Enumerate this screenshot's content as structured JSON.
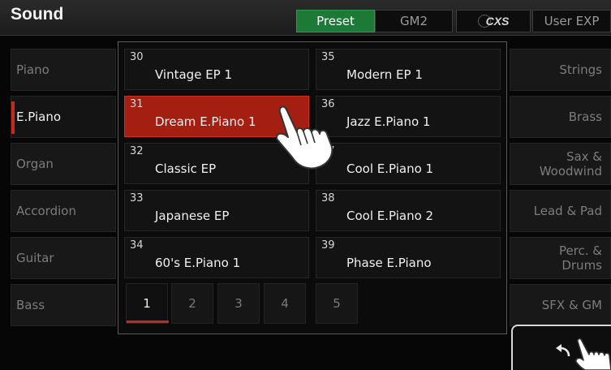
{
  "header": {
    "title": "Sound"
  },
  "tabs": [
    {
      "label": "Preset",
      "active": true
    },
    {
      "label": "GM2",
      "active": false
    },
    {
      "label": "CXS",
      "active": false
    },
    {
      "label": "User EXP",
      "active": false
    }
  ],
  "left_categories": [
    {
      "label": "Piano"
    },
    {
      "label": "E.Piano",
      "active": true
    },
    {
      "label": "Organ"
    },
    {
      "label": "Accordion"
    },
    {
      "label": "Guitar"
    },
    {
      "label": "Bass"
    }
  ],
  "right_categories": [
    {
      "label": "Strings"
    },
    {
      "label": "Brass"
    },
    {
      "label": "Sax &",
      "label2": "Woodwind"
    },
    {
      "label": "Lead & Pad"
    },
    {
      "label": "Perc. &",
      "label2": "Drums"
    },
    {
      "label": "SFX & GM"
    }
  ],
  "voices_left": [
    {
      "num": "30",
      "name": "Vintage EP 1"
    },
    {
      "num": "31",
      "name": "Dream E.Piano 1",
      "selected": true
    },
    {
      "num": "32",
      "name": "Classic EP"
    },
    {
      "num": "33",
      "name": "Japanese EP"
    },
    {
      "num": "34",
      "name": "60's E.Piano 1"
    }
  ],
  "voices_right": [
    {
      "num": "35",
      "name": "Modern EP 1"
    },
    {
      "num": "36",
      "name": "Jazz E.Piano 1"
    },
    {
      "num": "37",
      "name": "Cool E.Piano 1"
    },
    {
      "num": "38",
      "name": "Cool E.Piano 2"
    },
    {
      "num": "39",
      "name": "Phase E.Piano"
    }
  ],
  "pages": [
    "1",
    "2",
    "3",
    "4",
    "5"
  ],
  "current_page": "1",
  "icons": {
    "back": "return-arrow-icon",
    "hand": "pointing-hand-icon"
  },
  "colors": {
    "accent_red": "#a51e12",
    "tab_green": "#1c7a36"
  }
}
